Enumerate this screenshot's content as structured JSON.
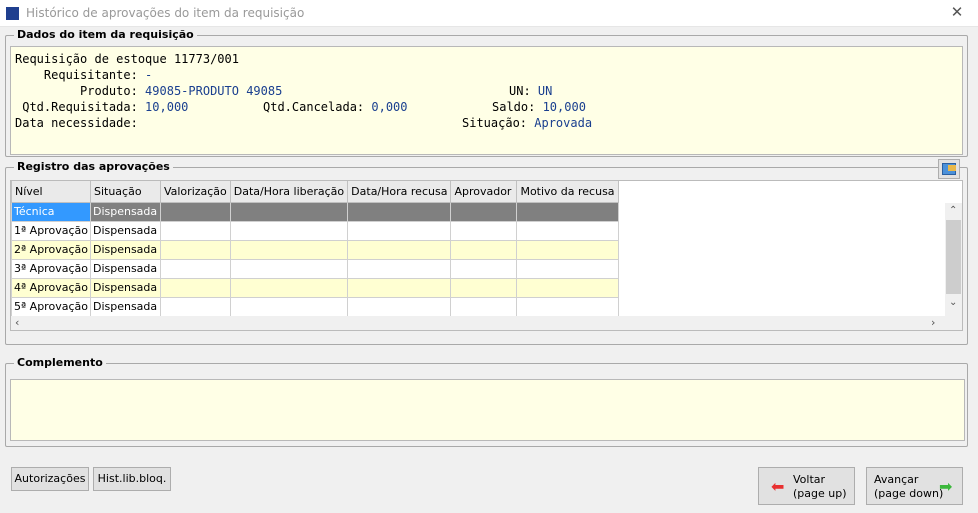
{
  "window": {
    "title": "Histórico de aprovações do item da requisição",
    "close": "✕"
  },
  "dados": {
    "label": "Dados do item da requisição",
    "line1": "Requisição de estoque 11773/001",
    "requisitante_label": "    Requisitante:",
    "requisitante": " -",
    "produto_label": "         Produto:",
    "produto": " 49085-PRODUTO 49085",
    "un_label": "UN:",
    "un": " UN",
    "qtd_req_label": " Qtd.Requisitada:",
    "qtd_req": " 10,000",
    "qtd_canc_label": "Qtd.Cancelada:",
    "qtd_canc": " 0,000",
    "saldo_label": "Saldo:",
    "saldo": " 10,000",
    "data_label": "Data necessidade:",
    "situacao_label": "Situação:",
    "situacao": " Aprovada"
  },
  "registro": {
    "label": "Registro das aprovações",
    "columns": [
      "Nível",
      "Situação",
      "Valorização",
      "Data/Hora liberação",
      "Data/Hora recusa",
      "Aprovador",
      "Motivo da recusa"
    ],
    "rows": [
      [
        "Técnica",
        "Dispensada"
      ],
      [
        "1ª Aprovação",
        "Dispensada"
      ],
      [
        "2ª Aprovação",
        "Dispensada"
      ],
      [
        "3ª Aprovação",
        "Dispensada"
      ],
      [
        "4ª Aprovação",
        "Dispensada"
      ],
      [
        "5ª Aprovação",
        "Dispensada"
      ]
    ]
  },
  "complemento": {
    "label": "Complemento"
  },
  "buttons": {
    "autorizacoes": "Autorizações",
    "hist": "Hist.lib.bloq.",
    "voltar": "Voltar",
    "voltar_sub": "(page up)",
    "avancar": "Avançar",
    "avancar_sub": "(page down)"
  }
}
